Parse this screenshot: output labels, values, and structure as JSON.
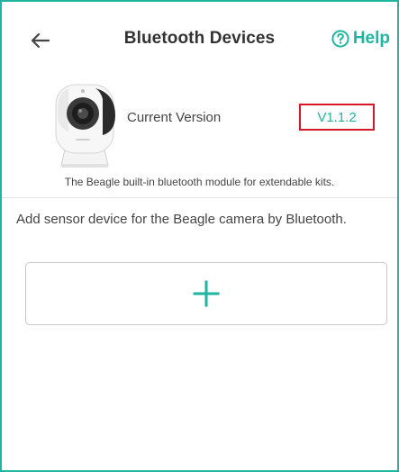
{
  "header": {
    "title": "Bluetooth Devices",
    "help_label": "Help"
  },
  "device": {
    "version_label": "Current Version",
    "version_value": "V1.1.2",
    "description": "The Beagle built-in bluetooth module for extendable kits."
  },
  "add_section": {
    "description": "Add sensor device for the Beagle camera by Bluetooth."
  },
  "icons": {
    "back": "back-arrow-icon",
    "help": "question-circle-icon",
    "add": "plus-icon"
  },
  "colors": {
    "accent": "#1fb6a1",
    "highlight_border": "#d7182a",
    "text": "#444444",
    "title": "#333333"
  }
}
